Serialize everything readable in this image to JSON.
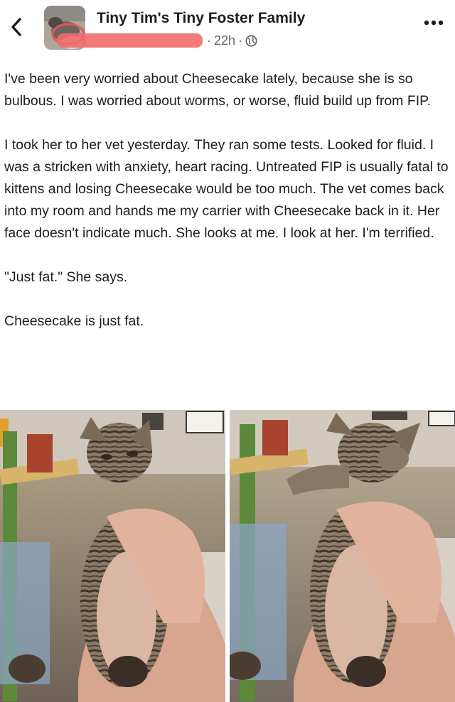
{
  "header": {
    "group_name": "Tiny Tim's Tiny Foster Family",
    "time": "22h",
    "dot": "·"
  },
  "icons": [
    "back-chevron-icon",
    "globe-icon",
    "more-options-icon"
  ],
  "post": {
    "paragraphs": [
      "I've been very worried about Cheesecake lately, because she is so bulbous. I was worried about worms, or worse, fluid build up from FIP.",
      "I took her to her vet yesterday. They ran some tests. Looked for fluid. I was a stricken with anxiety, heart racing. Untreated FIP is usually fatal to kittens and losing Cheesecake would be too much. The vet comes back into my room and hands me my carrier with Cheesecake back in it. Her face doesn't indicate much. She looks at me. I look at her. I'm terrified.",
      "\"Just fat.\" She says.",
      "Cheesecake is just fat."
    ]
  },
  "colors": {
    "text": "#1c1e21",
    "meta": "#65676b",
    "redaction": "#ef6b6b"
  }
}
